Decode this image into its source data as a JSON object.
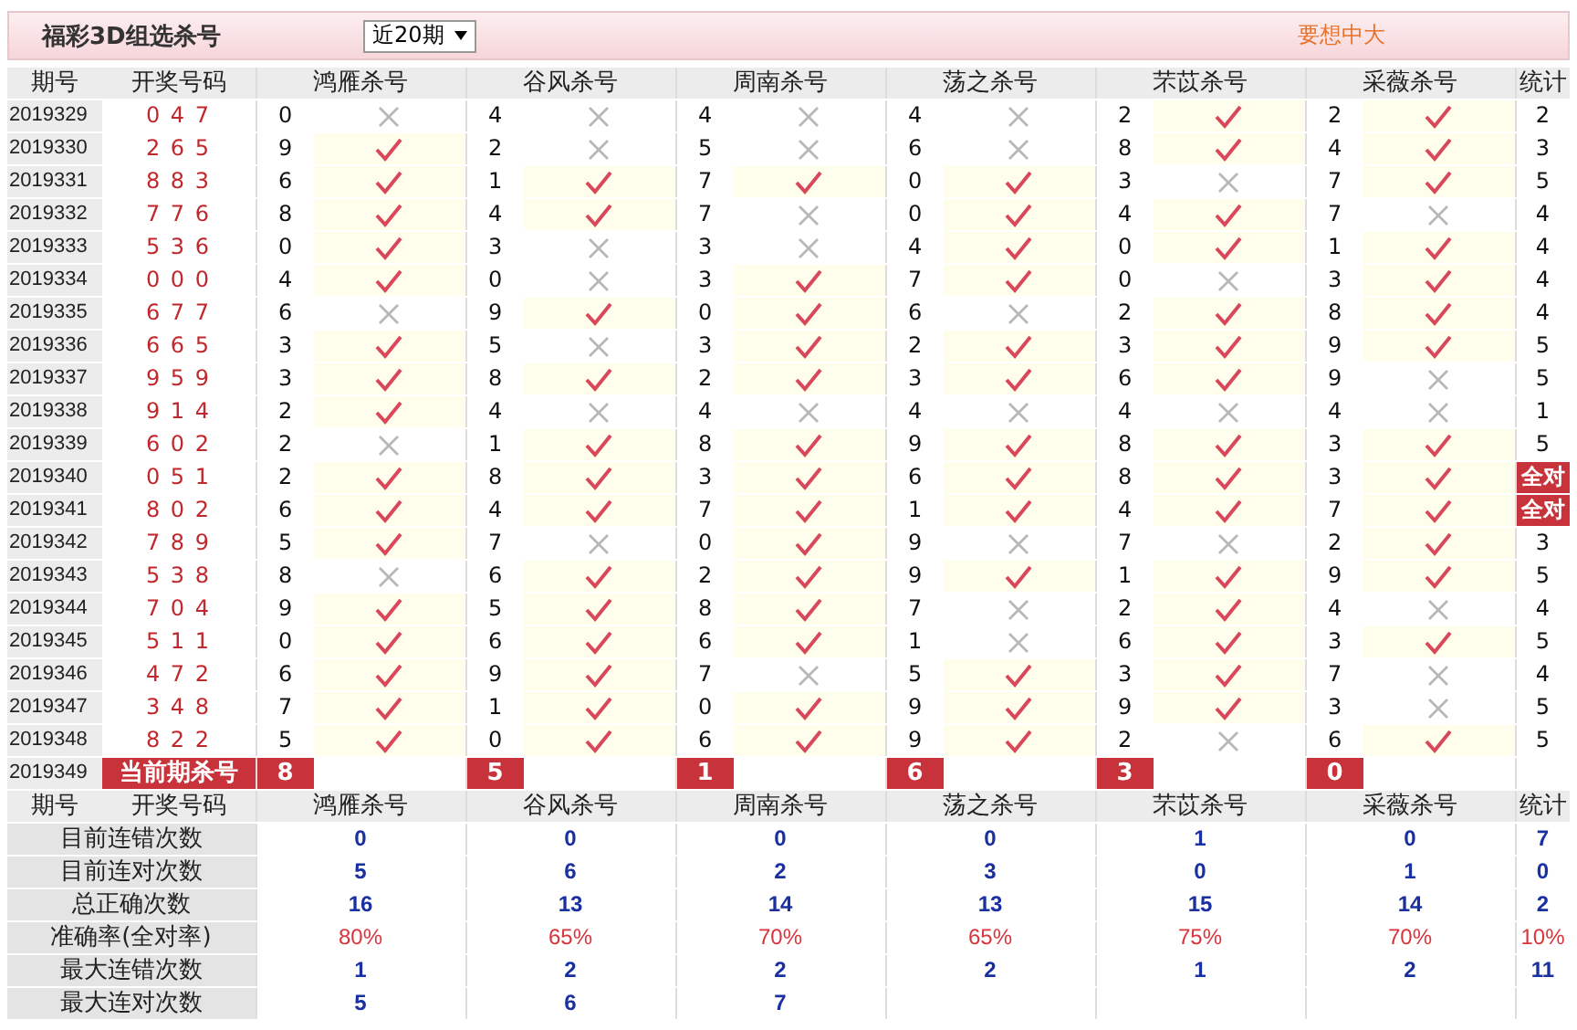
{
  "title_bar": {
    "title": "福彩3D组选杀号",
    "period_select": "近20期",
    "promo": "要想中大"
  },
  "columns": [
    "期号",
    "开奖号码",
    "鸿雁杀号",
    "谷风杀号",
    "周南杀号",
    "荡之杀号",
    "芣苡杀号",
    "采薇杀号",
    "统计"
  ],
  "rows": [
    {
      "period": "2019329",
      "draw": "0 4 7",
      "picks": [
        {
          "number": "0",
          "hit": false
        },
        {
          "number": "4",
          "hit": false
        },
        {
          "number": "4",
          "hit": false
        },
        {
          "number": "4",
          "hit": false
        },
        {
          "number": "2",
          "hit": true
        },
        {
          "number": "2",
          "hit": true
        }
      ],
      "count": "2",
      "full": false
    },
    {
      "period": "2019330",
      "draw": "2 6 5",
      "picks": [
        {
          "number": "9",
          "hit": true
        },
        {
          "number": "2",
          "hit": false
        },
        {
          "number": "5",
          "hit": false
        },
        {
          "number": "6",
          "hit": false
        },
        {
          "number": "8",
          "hit": true
        },
        {
          "number": "4",
          "hit": true
        }
      ],
      "count": "3",
      "full": false
    },
    {
      "period": "2019331",
      "draw": "8 8 3",
      "picks": [
        {
          "number": "6",
          "hit": true
        },
        {
          "number": "1",
          "hit": true
        },
        {
          "number": "7",
          "hit": true
        },
        {
          "number": "0",
          "hit": true
        },
        {
          "number": "3",
          "hit": false
        },
        {
          "number": "7",
          "hit": true
        }
      ],
      "count": "5",
      "full": false
    },
    {
      "period": "2019332",
      "draw": "7 7 6",
      "picks": [
        {
          "number": "8",
          "hit": true
        },
        {
          "number": "4",
          "hit": true
        },
        {
          "number": "7",
          "hit": false
        },
        {
          "number": "0",
          "hit": true
        },
        {
          "number": "4",
          "hit": true
        },
        {
          "number": "7",
          "hit": false
        }
      ],
      "count": "4",
      "full": false
    },
    {
      "period": "2019333",
      "draw": "5 3 6",
      "picks": [
        {
          "number": "0",
          "hit": true
        },
        {
          "number": "3",
          "hit": false
        },
        {
          "number": "3",
          "hit": false
        },
        {
          "number": "4",
          "hit": true
        },
        {
          "number": "0",
          "hit": true
        },
        {
          "number": "1",
          "hit": true
        }
      ],
      "count": "4",
      "full": false
    },
    {
      "period": "2019334",
      "draw": "0 0 0",
      "picks": [
        {
          "number": "4",
          "hit": true
        },
        {
          "number": "0",
          "hit": false
        },
        {
          "number": "3",
          "hit": true
        },
        {
          "number": "7",
          "hit": true
        },
        {
          "number": "0",
          "hit": false
        },
        {
          "number": "3",
          "hit": true
        }
      ],
      "count": "4",
      "full": false
    },
    {
      "period": "2019335",
      "draw": "6 7 7",
      "picks": [
        {
          "number": "6",
          "hit": false
        },
        {
          "number": "9",
          "hit": true
        },
        {
          "number": "0",
          "hit": true
        },
        {
          "number": "6",
          "hit": false
        },
        {
          "number": "2",
          "hit": true
        },
        {
          "number": "8",
          "hit": true
        }
      ],
      "count": "4",
      "full": false
    },
    {
      "period": "2019336",
      "draw": "6 6 5",
      "picks": [
        {
          "number": "3",
          "hit": true
        },
        {
          "number": "5",
          "hit": false
        },
        {
          "number": "3",
          "hit": true
        },
        {
          "number": "2",
          "hit": true
        },
        {
          "number": "3",
          "hit": true
        },
        {
          "number": "9",
          "hit": true
        }
      ],
      "count": "5",
      "full": false
    },
    {
      "period": "2019337",
      "draw": "9 5 9",
      "picks": [
        {
          "number": "3",
          "hit": true
        },
        {
          "number": "8",
          "hit": true
        },
        {
          "number": "2",
          "hit": true
        },
        {
          "number": "3",
          "hit": true
        },
        {
          "number": "6",
          "hit": true
        },
        {
          "number": "9",
          "hit": false
        }
      ],
      "count": "5",
      "full": false
    },
    {
      "period": "2019338",
      "draw": "9 1 4",
      "picks": [
        {
          "number": "2",
          "hit": true
        },
        {
          "number": "4",
          "hit": false
        },
        {
          "number": "4",
          "hit": false
        },
        {
          "number": "4",
          "hit": false
        },
        {
          "number": "4",
          "hit": false
        },
        {
          "number": "4",
          "hit": false
        }
      ],
      "count": "1",
      "full": false
    },
    {
      "period": "2019339",
      "draw": "6 0 2",
      "picks": [
        {
          "number": "2",
          "hit": false
        },
        {
          "number": "1",
          "hit": true
        },
        {
          "number": "8",
          "hit": true
        },
        {
          "number": "9",
          "hit": true
        },
        {
          "number": "8",
          "hit": true
        },
        {
          "number": "3",
          "hit": true
        }
      ],
      "count": "5",
      "full": false
    },
    {
      "period": "2019340",
      "draw": "0 5 1",
      "picks": [
        {
          "number": "2",
          "hit": true
        },
        {
          "number": "8",
          "hit": true
        },
        {
          "number": "3",
          "hit": true
        },
        {
          "number": "6",
          "hit": true
        },
        {
          "number": "8",
          "hit": true
        },
        {
          "number": "3",
          "hit": true
        }
      ],
      "count": "全对",
      "full": true
    },
    {
      "period": "2019341",
      "draw": "8 0 2",
      "picks": [
        {
          "number": "6",
          "hit": true
        },
        {
          "number": "4",
          "hit": true
        },
        {
          "number": "7",
          "hit": true
        },
        {
          "number": "1",
          "hit": true
        },
        {
          "number": "4",
          "hit": true
        },
        {
          "number": "7",
          "hit": true
        }
      ],
      "count": "全对",
      "full": true
    },
    {
      "period": "2019342",
      "draw": "7 8 9",
      "picks": [
        {
          "number": "5",
          "hit": true
        },
        {
          "number": "7",
          "hit": false
        },
        {
          "number": "0",
          "hit": true
        },
        {
          "number": "9",
          "hit": false
        },
        {
          "number": "7",
          "hit": false
        },
        {
          "number": "2",
          "hit": true
        }
      ],
      "count": "3",
      "full": false
    },
    {
      "period": "2019343",
      "draw": "5 3 8",
      "picks": [
        {
          "number": "8",
          "hit": false
        },
        {
          "number": "6",
          "hit": true
        },
        {
          "number": "2",
          "hit": true
        },
        {
          "number": "9",
          "hit": true
        },
        {
          "number": "1",
          "hit": true
        },
        {
          "number": "9",
          "hit": true
        }
      ],
      "count": "5",
      "full": false
    },
    {
      "period": "2019344",
      "draw": "7 0 4",
      "picks": [
        {
          "number": "9",
          "hit": true
        },
        {
          "number": "5",
          "hit": true
        },
        {
          "number": "8",
          "hit": true
        },
        {
          "number": "7",
          "hit": false
        },
        {
          "number": "2",
          "hit": true
        },
        {
          "number": "4",
          "hit": false
        }
      ],
      "count": "4",
      "full": false
    },
    {
      "period": "2019345",
      "draw": "5 1 1",
      "picks": [
        {
          "number": "0",
          "hit": true
        },
        {
          "number": "6",
          "hit": true
        },
        {
          "number": "6",
          "hit": true
        },
        {
          "number": "1",
          "hit": false
        },
        {
          "number": "6",
          "hit": true
        },
        {
          "number": "3",
          "hit": true
        }
      ],
      "count": "5",
      "full": false
    },
    {
      "period": "2019346",
      "draw": "4 7 2",
      "picks": [
        {
          "number": "6",
          "hit": true
        },
        {
          "number": "9",
          "hit": true
        },
        {
          "number": "7",
          "hit": false
        },
        {
          "number": "5",
          "hit": true
        },
        {
          "number": "3",
          "hit": true
        },
        {
          "number": "7",
          "hit": false
        }
      ],
      "count": "4",
      "full": false
    },
    {
      "period": "2019347",
      "draw": "3 4 8",
      "picks": [
        {
          "number": "7",
          "hit": true
        },
        {
          "number": "1",
          "hit": true
        },
        {
          "number": "0",
          "hit": true
        },
        {
          "number": "9",
          "hit": true
        },
        {
          "number": "9",
          "hit": true
        },
        {
          "number": "3",
          "hit": false
        }
      ],
      "count": "5",
      "full": false
    },
    {
      "period": "2019348",
      "draw": "8 2 2",
      "picks": [
        {
          "number": "5",
          "hit": true
        },
        {
          "number": "0",
          "hit": true
        },
        {
          "number": "6",
          "hit": true
        },
        {
          "number": "9",
          "hit": true
        },
        {
          "number": "2",
          "hit": false
        },
        {
          "number": "6",
          "hit": true
        }
      ],
      "count": "5",
      "full": false
    }
  ],
  "current": {
    "period": "2019349",
    "label": "当前期杀号",
    "picks": [
      "8",
      "5",
      "1",
      "6",
      "3",
      "0"
    ]
  },
  "footer_columns": [
    "期号",
    "开奖号码",
    "鸿雁杀号",
    "谷风杀号",
    "周南杀号",
    "荡之杀号",
    "芣苡杀号",
    "采薇杀号",
    "统计"
  ],
  "stats": [
    {
      "label": "目前连错次数",
      "kind": "count",
      "values": [
        "0",
        "0",
        "0",
        "0",
        "1",
        "0",
        "7"
      ]
    },
    {
      "label": "目前连对次数",
      "kind": "count",
      "values": [
        "5",
        "6",
        "2",
        "3",
        "0",
        "1",
        "0"
      ]
    },
    {
      "label": "总正确次数",
      "kind": "count",
      "values": [
        "16",
        "13",
        "14",
        "13",
        "15",
        "14",
        "2"
      ]
    },
    {
      "label": "准确率(全对率)",
      "kind": "rate",
      "values": [
        "80%",
        "65%",
        "70%",
        "65%",
        "75%",
        "70%",
        "10%"
      ]
    },
    {
      "label": "最大连错次数",
      "kind": "count",
      "values": [
        "1",
        "2",
        "2",
        "2",
        "1",
        "2",
        "11"
      ]
    },
    {
      "label": "最大连对次数",
      "kind": "count",
      "values": [
        "5",
        "6",
        "7"
      ]
    }
  ]
}
